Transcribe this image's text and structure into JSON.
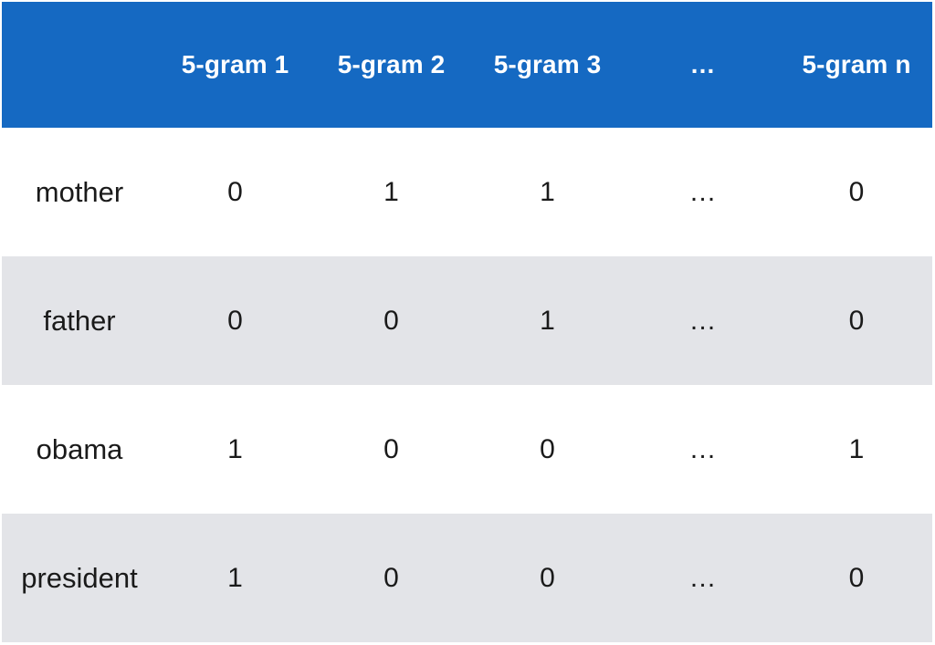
{
  "table": {
    "name": "5-gram feature matrix",
    "colors": {
      "header_background": "#1569C2",
      "header_text": "#FFFFFF",
      "row_background": "#FFFFFF",
      "row_background_alt": "#E3E4E8",
      "body_text": "#1A1A1A"
    },
    "corner_header": "",
    "columns": [
      "5-gram 1",
      "5-gram 2",
      "5-gram 3",
      "…",
      "5-gram n"
    ],
    "rows": [
      {
        "label": "mother",
        "values": [
          "0",
          "1",
          "1",
          "…",
          "0"
        ]
      },
      {
        "label": "father",
        "values": [
          "0",
          "0",
          "1",
          "…",
          "0"
        ]
      },
      {
        "label": "obama",
        "values": [
          "1",
          "0",
          "0",
          "…",
          "1"
        ]
      },
      {
        "label": "president",
        "values": [
          "1",
          "0",
          "0",
          "…",
          "0"
        ]
      }
    ]
  }
}
